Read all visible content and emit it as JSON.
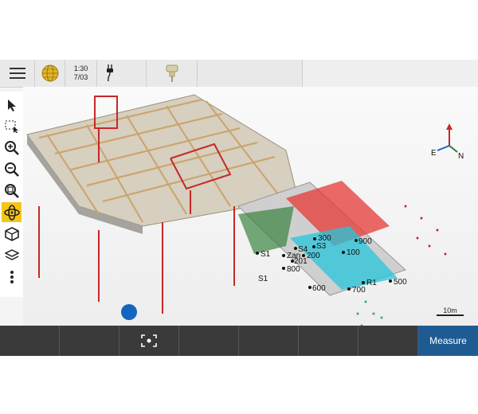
{
  "topbar": {
    "time_line1": "1:30",
    "time_line2": "7/03"
  },
  "viewport": {
    "point_labels": [
      {
        "id": "p300",
        "text": "300"
      },
      {
        "id": "p900",
        "text": "900"
      },
      {
        "id": "p100",
        "text": "100"
      },
      {
        "id": "p800",
        "text": "800"
      },
      {
        "id": "p600",
        "text": "600"
      },
      {
        "id": "p700",
        "text": "700"
      },
      {
        "id": "pR1",
        "text": "R1"
      },
      {
        "id": "p500",
        "text": "500"
      },
      {
        "id": "pS1",
        "text": "S1"
      },
      {
        "id": "pS3",
        "text": "S3"
      },
      {
        "id": "pS4",
        "text": "S4"
      },
      {
        "id": "p200",
        "text": "200"
      },
      {
        "id": "pZan",
        "text": "Zan"
      },
      {
        "id": "p201",
        "text": "201"
      },
      {
        "id": "pS1b",
        "text": "S1"
      }
    ],
    "axes": {
      "x": "E",
      "y": "N"
    },
    "scale_label": "10m"
  },
  "bottombar": {
    "measure_label": "Measure"
  },
  "colors": {
    "accent_active_tool": "#f5c518",
    "measure_button": "#1f5b93",
    "bottombar": "#3a3a3a",
    "frame_wood": "#c9a46a",
    "frame_red": "#c62828",
    "scan_red": "#e53935",
    "scan_cyan": "#26c6da",
    "scan_green": "#2e7d32",
    "marker_blue": "#1565c0"
  },
  "icons": [
    "hamburger-menu-icon",
    "globe-icon",
    "power-plug-icon",
    "probe-sensor-icon",
    "select-arrow-icon",
    "box-select-icon",
    "zoom-in-icon",
    "zoom-out-icon",
    "zoom-extents-icon",
    "orbit-icon",
    "view-cube-icon",
    "layers-icon",
    "more-vertical-icon",
    "focus-target-icon"
  ]
}
